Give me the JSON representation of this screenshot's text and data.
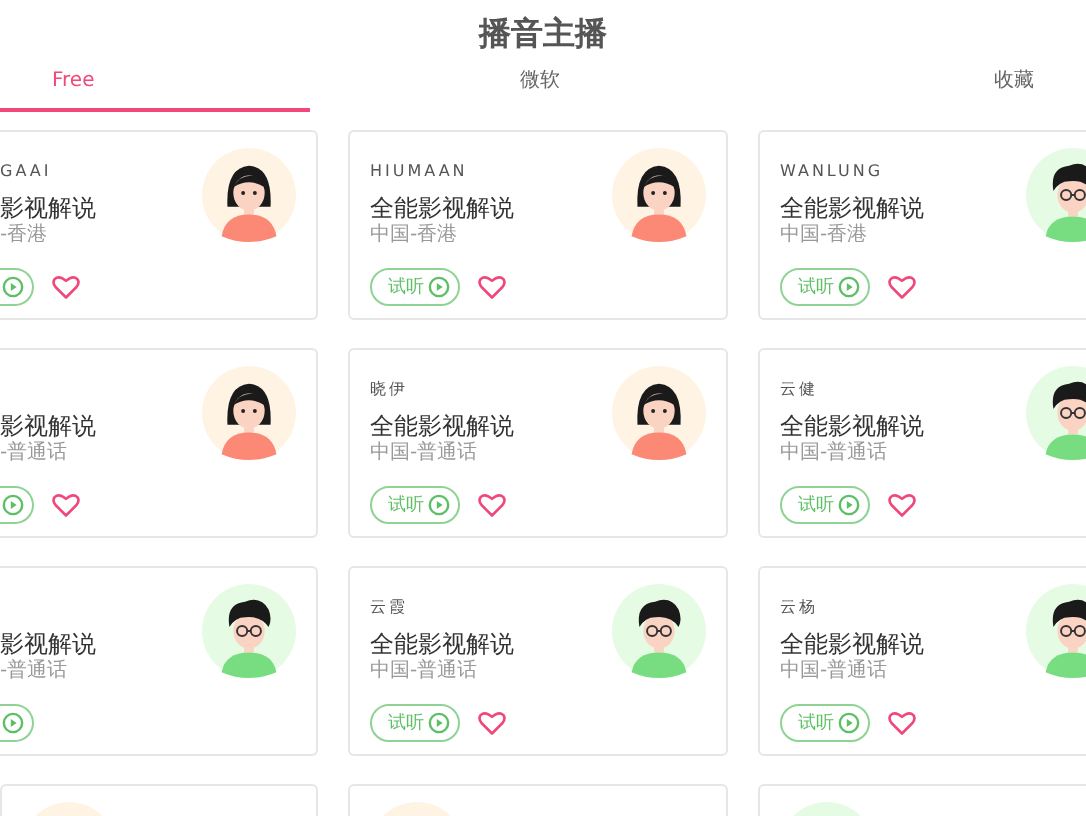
{
  "title": "播音主播",
  "tabs": [
    {
      "label": "Free",
      "selected": true
    },
    {
      "label": "微软",
      "selected": false
    },
    {
      "label": "收藏",
      "selected": false
    }
  ],
  "rows": [
    {
      "cards": [
        {
          "kind": "clipped",
          "name": "GAAI",
          "title": "影视解说",
          "region": "-香港",
          "avatar": {
            "kind": "girl"
          },
          "heart": {
            "liked": false
          }
        },
        {
          "kind": "full",
          "name": "HIUMAAN",
          "title": "全能影视解说",
          "region": "中国-香港",
          "avatar": {
            "kind": "girl"
          },
          "listen": "试听",
          "heart": {
            "liked": false
          }
        },
        {
          "kind": "full",
          "name": "WANLUNG",
          "title": "全能影视解说",
          "region": "中国-香港",
          "avatar": {
            "kind": "boy"
          },
          "listen": "试听",
          "heart": {
            "liked": false
          }
        }
      ]
    },
    {
      "cards": [
        {
          "kind": "clipped",
          "title": "影视解说",
          "region": "-普通话",
          "avatar": {
            "kind": "girl"
          },
          "heart": {
            "liked": false
          }
        },
        {
          "kind": "full",
          "name": "晓伊",
          "title": "全能影视解说",
          "region": "中国-普通话",
          "avatar": {
            "kind": "girl"
          },
          "listen": "试听",
          "heart": {
            "liked": false
          }
        },
        {
          "kind": "full",
          "name": "云健",
          "title": "全能影视解说",
          "region": "中国-普通话",
          "avatar": {
            "kind": "boy"
          },
          "listen": "试听",
          "heart": {
            "liked": false
          }
        }
      ]
    },
    {
      "cards": [
        {
          "kind": "clipped",
          "title": "影视解说",
          "region": "-普通话",
          "avatar": {
            "kind": "boy"
          }
        },
        {
          "kind": "full",
          "name": "云霞",
          "title": "全能影视解说",
          "region": "中国-普通话",
          "avatar": {
            "kind": "boy"
          },
          "listen": "试听",
          "heart": {
            "liked": false
          }
        },
        {
          "kind": "full",
          "name": "云杨",
          "title": "全能影视解说",
          "region": "中国-普通话",
          "avatar": {
            "kind": "boy"
          },
          "listen": "试听",
          "heart": {
            "liked": false
          }
        }
      ]
    },
    {
      "cards": [
        {
          "kind": "stub",
          "avatar": {
            "kind": "girl"
          }
        },
        {
          "kind": "stub",
          "avatar": {
            "kind": "girl"
          }
        },
        {
          "kind": "stub",
          "avatar": {
            "kind": "boy"
          }
        }
      ]
    }
  ]
}
